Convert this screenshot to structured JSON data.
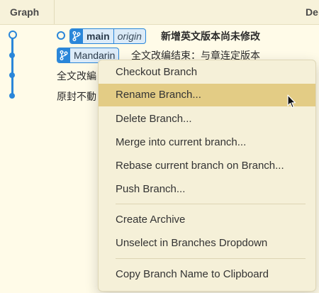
{
  "header": {
    "graph_label": "Graph",
    "desc_label": "De"
  },
  "rows": [
    {
      "branch": "main",
      "remote": "origin",
      "message": "新增英文版本尚未修改"
    },
    {
      "branch": "Mandarin",
      "message": "全文改编结束：与章连定版本"
    },
    {
      "message": "全文改編"
    },
    {
      "message": "原封不動"
    }
  ],
  "menu": {
    "items": [
      "Checkout Branch",
      "Rename Branch...",
      "Delete Branch...",
      "Merge into current branch...",
      "Rebase current branch on Branch...",
      "Push Branch...",
      "Create Archive",
      "Unselect in Branches Dropdown",
      "Copy Branch Name to Clipboard"
    ],
    "highlighted": "Rename Branch..."
  },
  "colors": {
    "accent": "#2a86d9",
    "highlight": "#e3cc85",
    "background": "#fffbe8"
  }
}
